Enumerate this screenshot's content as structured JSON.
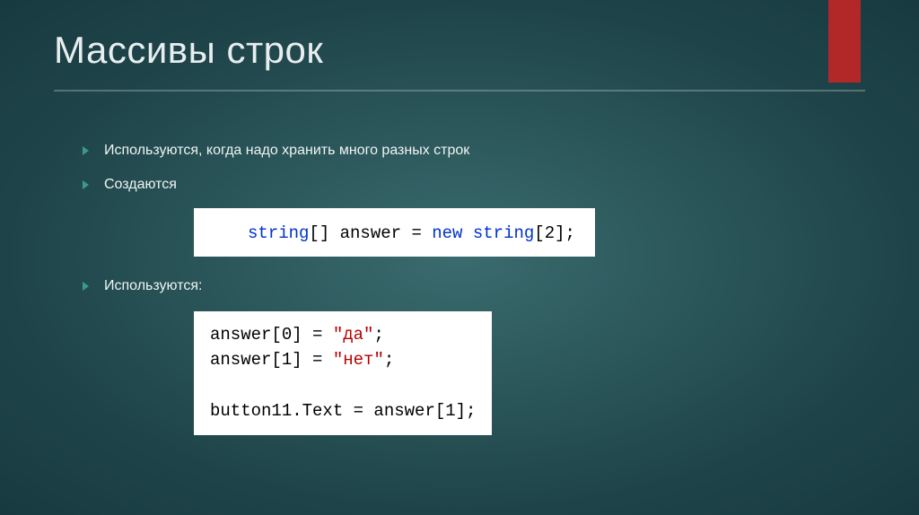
{
  "title": "Массивы строк",
  "bullets": {
    "b1": "Используются, когда надо хранить много разных строк",
    "b2": "Создаются",
    "b3": "Используются:"
  },
  "code1": {
    "t1": "string",
    "t2": "[] answer = ",
    "t3": "new ",
    "t4": "string",
    "t5": "[",
    "t6": "2",
    "t7": "];"
  },
  "code2": {
    "l1a": "answer[",
    "l1b": "0",
    "l1c": "] = ",
    "l1d": "\"да\"",
    "l1e": ";",
    "l2a": "answer[",
    "l2b": "1",
    "l2c": "] = ",
    "l2d": "\"нет\"",
    "l2e": ";",
    "l3": "",
    "l4": "button11.Text = answer[",
    "l4b": "1",
    "l4c": "];"
  }
}
